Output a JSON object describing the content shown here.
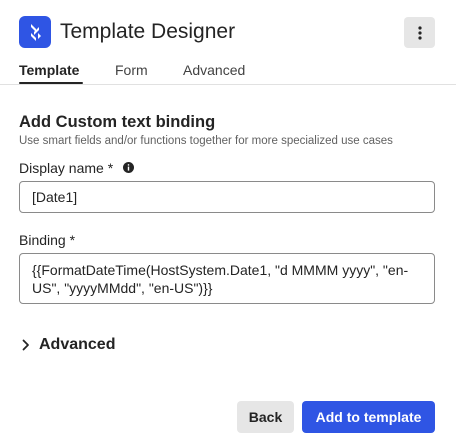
{
  "header": {
    "title": "Template Designer",
    "logo_icon": "brand-logo-icon",
    "menu_icon": "more-vertical-icon",
    "brand_color": "#2f55e4"
  },
  "tabs": [
    {
      "label": "Template",
      "active": true
    },
    {
      "label": "Form",
      "active": false
    },
    {
      "label": "Advanced",
      "active": false
    }
  ],
  "section": {
    "title": "Add Custom text binding",
    "description": "Use smart fields and/or functions together for more specialized use cases"
  },
  "display_name": {
    "label": "Display name *",
    "info_icon": "info-icon",
    "value": "[Date1]"
  },
  "binding": {
    "label": "Binding *",
    "value": "{{FormatDateTime(HostSystem.Date1, \"d MMMM yyyy\", \"en-US\", \"yyyyMMdd\", \"en-US\")}}"
  },
  "advanced": {
    "label": "Advanced",
    "expanded": false,
    "icon": "chevron-right-icon"
  },
  "actions": {
    "back_label": "Back",
    "add_label": "Add to template",
    "primary_color": "#2f55e4"
  }
}
